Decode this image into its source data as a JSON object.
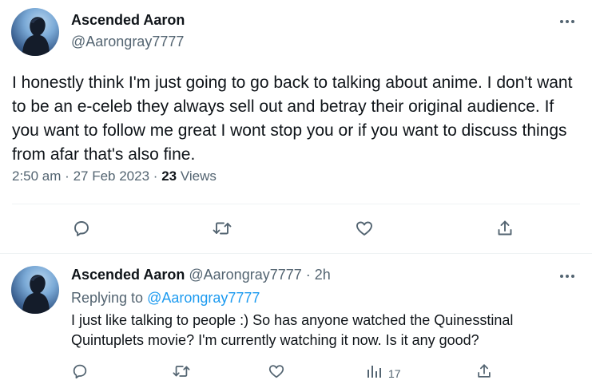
{
  "main_tweet": {
    "display_name": "Ascended Aaron",
    "handle": "@Aarongray7777",
    "text": "I honestly think I'm just going to go back to talking about anime. I don't want to be an e-celeb they always sell out and betray their original audience. If you want to follow me great I wont stop you or if you want to discuss things from afar that's also fine.",
    "time": "2:50 am",
    "date": "27 Feb 2023",
    "views_count": "23",
    "views_label": "Views"
  },
  "reply_tweet": {
    "display_name": "Ascended Aaron",
    "handle": "@Aarongray7777",
    "age": "2h",
    "replying_to_label": "Replying to",
    "replying_to_handle": "@Aarongray7777",
    "text": "I just like talking to people :) So has anyone watched the Quinesstinal Quintuplets movie? I'm currently watching it now. Is it any good?",
    "views_count": "17"
  },
  "separators": {
    "dot": "·"
  },
  "icons": [
    "more-icon",
    "reply-icon",
    "retweet-icon",
    "like-icon",
    "share-icon",
    "views-icon"
  ],
  "colors": {
    "text": "#0f1419",
    "secondary": "#536471",
    "link": "#1d9bf0",
    "divider": "#eff3f4"
  }
}
